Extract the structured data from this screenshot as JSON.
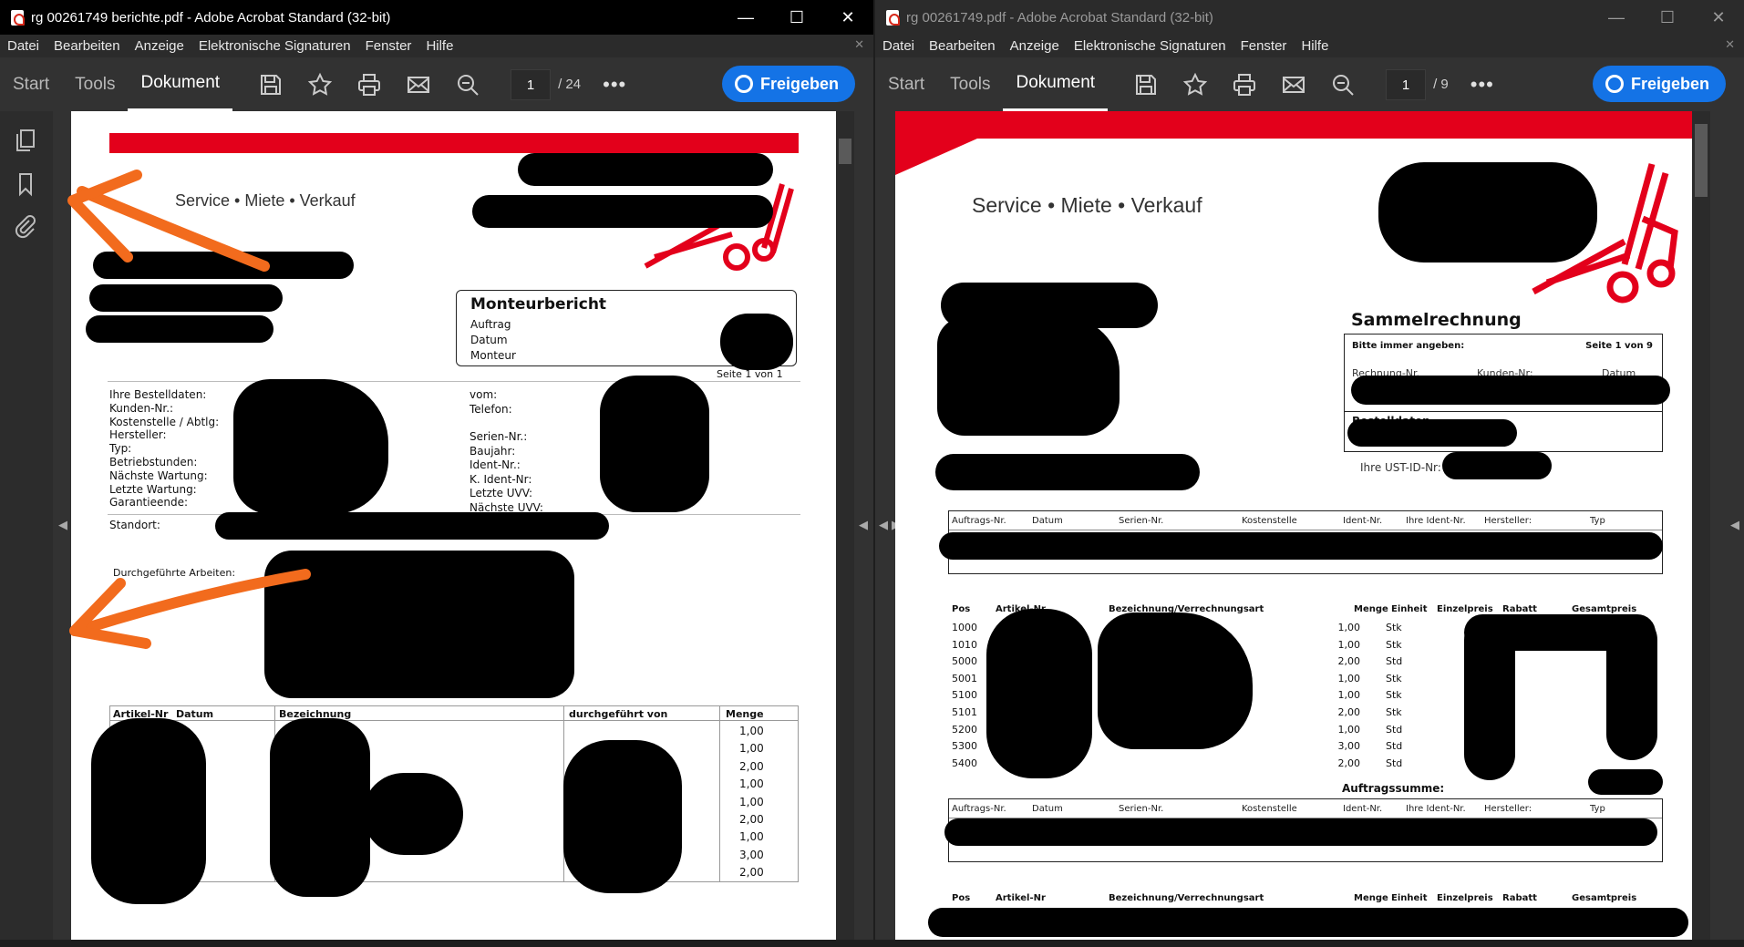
{
  "left_window": {
    "title": "rg 00261749 berichte.pdf - Adobe Acrobat Standard  (32-bit)",
    "menu": [
      "Datei",
      "Bearbeiten",
      "Anzeige",
      "Elektronische Signaturen",
      "Fenster",
      "Hilfe"
    ],
    "nav": {
      "start": "Start",
      "tools": "Tools",
      "document": "Dokument"
    },
    "page_current": "1",
    "page_total": "/ 24",
    "share": "Freigeben",
    "doc": {
      "tagline": "Service • Miete • Verkauf",
      "report_title": "Monteurbericht",
      "report_fields": [
        "Auftrag",
        "Datum",
        "Monteur"
      ],
      "page_info": "Seite 1 von 1",
      "left_labels": [
        "Ihre Bestelldaten:",
        "Kunden-Nr.:",
        "Kostenstelle / Abtlg:",
        "Hersteller:",
        "Typ:",
        "Betriebstunden:",
        "Nächste Wartung:",
        "Letzte Wartung:",
        "Garantieende:"
      ],
      "right_labels": [
        "vom:",
        "Telefon:",
        "",
        "Serien-Nr.:",
        "Baujahr:",
        "Ident-Nr.:",
        "K. Ident-Nr:",
        "Letzte UVV:",
        "Nächste UVV:"
      ],
      "standort": "Standort:",
      "arbeiten": "Durchgeführte Arbeiten:",
      "table_headers": [
        "Artikel-Nr",
        "Datum",
        "Bezeichnung",
        "durchgeführt von",
        "Menge"
      ],
      "mengen": [
        "1,00",
        "1,00",
        "2,00",
        "1,00",
        "1,00",
        "2,00",
        "1,00",
        "3,00",
        "2,00"
      ]
    }
  },
  "right_window": {
    "title": "rg 00261749.pdf - Adobe Acrobat Standard  (32-bit)",
    "menu": [
      "Datei",
      "Bearbeiten",
      "Anzeige",
      "Elektronische Signaturen",
      "Fenster",
      "Hilfe"
    ],
    "nav": {
      "start": "Start",
      "tools": "Tools",
      "document": "Dokument"
    },
    "page_current": "1",
    "page_total": "/ 9",
    "share": "Freigeben",
    "doc": {
      "tagline": "Service • Miete • Verkauf",
      "invoice_title": "Sammelrechnung",
      "please_note": "Bitte immer angeben:",
      "page_info": "Seite 1 von 9",
      "ref_labels": [
        "Rechnung-Nr.",
        "Kunden-Nr:",
        "Datum"
      ],
      "bestelldaten": "Bestelldaten",
      "ust": "Ihre UST-ID-Nr:",
      "order_headers": [
        "Auftrags-Nr.",
        "Datum",
        "Serien-Nr.",
        "Kostenstelle",
        "Ident-Nr.",
        "Ihre Ident-Nr.",
        "Hersteller:",
        "Typ"
      ],
      "pos_headers": [
        "Pos",
        "Artikel-Nr",
        "Bezeichnung/Verrechnungsart",
        "Menge",
        "Einheit",
        "Einzelpreis",
        "Rabatt",
        "Gesamtpreis"
      ],
      "positions": [
        {
          "pos": "1000",
          "menge": "1,00",
          "einheit": "Stk"
        },
        {
          "pos": "1010",
          "menge": "1,00",
          "einheit": "Stk"
        },
        {
          "pos": "5000",
          "menge": "2,00",
          "einheit": "Std"
        },
        {
          "pos": "5001",
          "menge": "1,00",
          "einheit": "Stk"
        },
        {
          "pos": "5100",
          "menge": "1,00",
          "einheit": "Stk"
        },
        {
          "pos": "5101",
          "menge": "2,00",
          "einheit": "Stk"
        },
        {
          "pos": "5200",
          "menge": "1,00",
          "einheit": "Std"
        },
        {
          "pos": "5300",
          "menge": "3,00",
          "einheit": "Std"
        },
        {
          "pos": "5400",
          "menge": "2,00",
          "einheit": "Std"
        }
      ],
      "auftragssumme": "Auftragssumme:"
    }
  },
  "colors": {
    "accent_red": "#e3001b",
    "share_blue": "#1473e6",
    "annotation_orange": "#f26b1d"
  },
  "icons": [
    "save-icon",
    "star-icon",
    "print-icon",
    "mail-icon",
    "zoom-icon",
    "more-icon",
    "pages-icon",
    "bookmark-icon",
    "attachment-icon"
  ]
}
